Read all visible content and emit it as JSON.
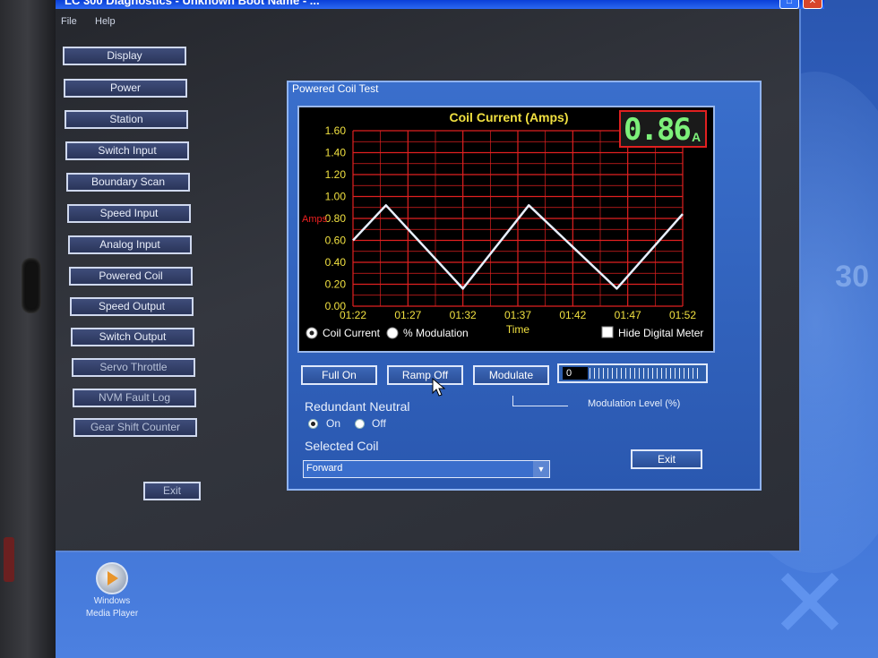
{
  "window": {
    "title": "LC 300 Diagnostics - Unknown Boot Name - ..."
  },
  "menu": [
    "File",
    "Help"
  ],
  "nav": [
    "Display",
    "Power",
    "Station",
    "Switch Input",
    "Boundary Scan",
    "Speed Input",
    "Analog Input",
    "Powered Coil",
    "Speed Output",
    "Switch Output",
    "Servo Throttle",
    "NVM Fault Log",
    "Gear Shift Counter"
  ],
  "exit_main": "Exit",
  "panel": {
    "title": "Powered Coil Test",
    "radios": {
      "coil_current": "Coil Current",
      "modulation": "% Modulation",
      "selected": "coil_current"
    },
    "hide_meter": "Hide Digital Meter",
    "buttons": {
      "full_on": "Full On",
      "ramp_off": "Ramp Off",
      "modulate": "Modulate",
      "exit": "Exit"
    },
    "modulation_value": "0",
    "modulation_label": "Modulation Level (%)",
    "redundant_neutral": {
      "label": "Redundant Neutral",
      "on": "On",
      "off": "Off",
      "selected": "on"
    },
    "selected_coil": {
      "label": "Selected Coil",
      "value": "Forward"
    }
  },
  "digital_meter": {
    "value": "0.86",
    "unit": "A"
  },
  "colors": {
    "grid": "#e02020",
    "trace": "#e8f0ff",
    "title": "#f0e040",
    "ticks": "#f0e040",
    "ylabel": "#f02020",
    "meter": "#7df07a"
  },
  "desktop": {
    "watermark": "30",
    "icon_label_1": "Windows",
    "icon_label_2": "Media Player"
  },
  "chart_data": {
    "type": "line",
    "title": "Coil Current (Amps)",
    "ylabel": "Amps",
    "xlabel": "Time",
    "x_ticks": [
      "01:22",
      "01:27",
      "01:32",
      "01:37",
      "01:42",
      "01:47",
      "01:52"
    ],
    "y_ticks": [
      "0.00",
      "0.20",
      "0.40",
      "0.60",
      "0.80",
      "1.00",
      "1.20",
      "1.40",
      "1.60"
    ],
    "ylim": [
      0,
      1.6
    ],
    "grid": true,
    "series": [
      {
        "x": [
          "01:22",
          "01:25",
          "01:32",
          "01:38",
          "01:46",
          "01:52"
        ],
        "values": [
          0.6,
          0.92,
          0.16,
          0.92,
          0.16,
          0.84
        ]
      }
    ]
  }
}
